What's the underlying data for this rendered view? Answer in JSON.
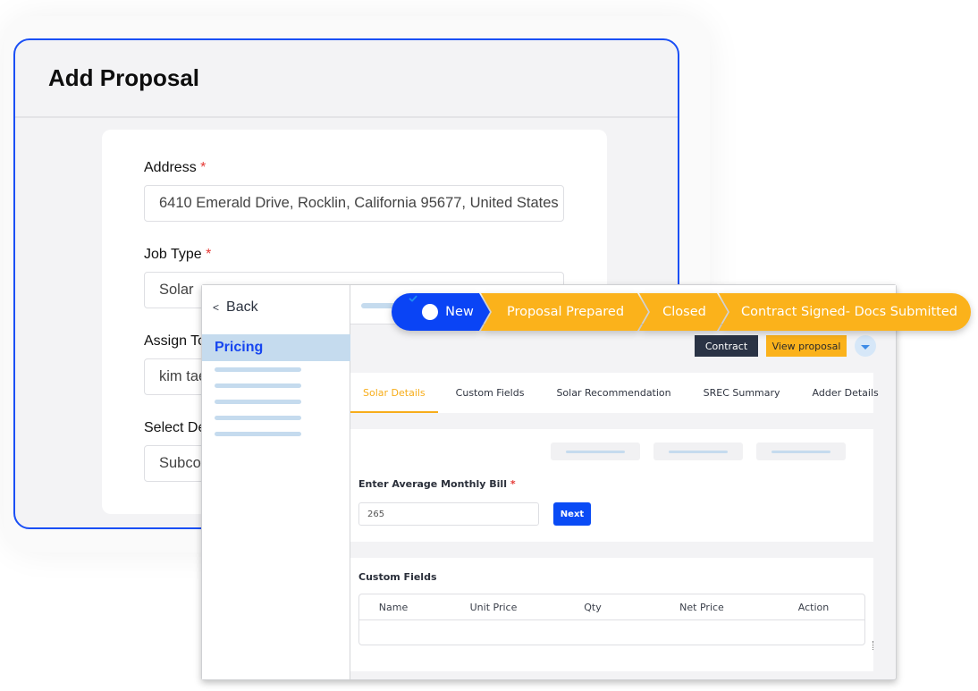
{
  "proposal_form": {
    "title": "Add Proposal",
    "fields": [
      {
        "label": "Address",
        "required": "*",
        "value": "6410 Emerald Drive, Rocklin, California 95677, United States"
      },
      {
        "label": "Job Type",
        "required": "*",
        "value": "Solar"
      },
      {
        "label": "Assign To",
        "required": "",
        "value": "kim tae"
      },
      {
        "label": "Select De",
        "required": "",
        "value": "Subcon"
      }
    ]
  },
  "side_nav": {
    "back_label": "Back",
    "active_item": "Pricing"
  },
  "pipeline": {
    "stages": [
      {
        "label": "New",
        "state": "completed",
        "icon": "check-circle-icon"
      },
      {
        "label": "Proposal Prepared",
        "state": "pending"
      },
      {
        "label": "Closed",
        "state": "pending"
      },
      {
        "label": "Contract Signed- Docs Submitted",
        "state": "pending"
      }
    ],
    "colors": {
      "completed": "#0a44f5",
      "pending": "#fbb21b"
    }
  },
  "actions": {
    "contract_label": "Contract",
    "view_proposal_label": "View proposal",
    "dropdown_icon": "caret-down-icon"
  },
  "tabs": [
    {
      "label": "Solar Details",
      "active": true
    },
    {
      "label": "Custom Fields",
      "active": false
    },
    {
      "label": "Solar Recommendation",
      "active": false
    },
    {
      "label": "SREC Summary",
      "active": false
    },
    {
      "label": "Adder Details",
      "active": false
    }
  ],
  "bill": {
    "label": "Enter Average Monthly Bill",
    "required": "*",
    "value": "265",
    "next_label": "Next"
  },
  "custom_fields": {
    "title": "Custom Fields",
    "columns": [
      "Name",
      "Unit Price",
      "Qty",
      "Net Price",
      "Action"
    ],
    "rows": []
  }
}
